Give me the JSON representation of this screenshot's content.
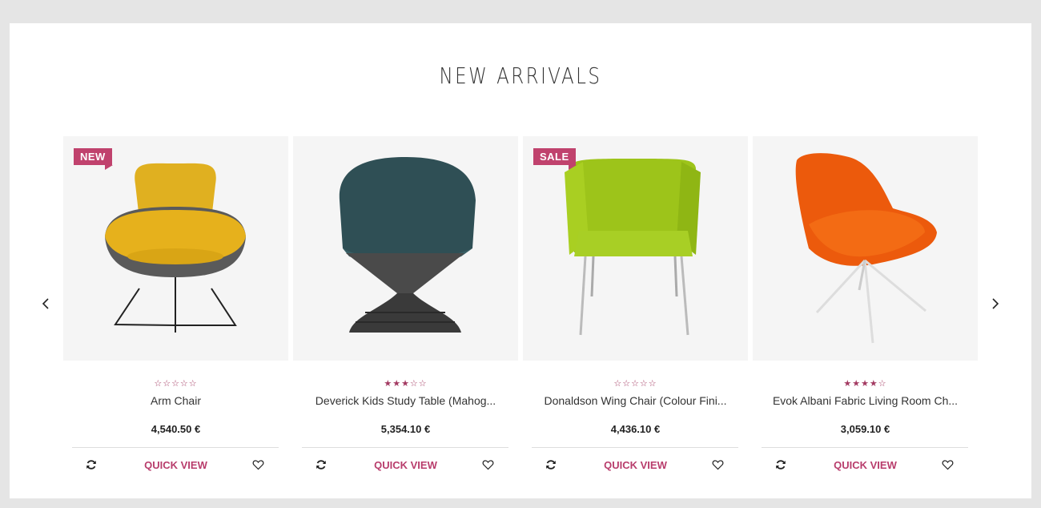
{
  "section": {
    "title": "NEW ARRIVALS"
  },
  "carousel": {
    "prev_icon": "chevron-left-icon",
    "next_icon": "chevron-right-icon"
  },
  "colors": {
    "accent": "#b83d6c",
    "badge_bg": "#c0426d",
    "image_bg": "#f5f5f5"
  },
  "products": [
    {
      "name": "Arm Chair",
      "price": "4,540.50 €",
      "rating": 0,
      "stars": "☆☆☆☆☆",
      "badge": "NEW",
      "quick_view": "QUICK VIEW"
    },
    {
      "name": "Deverick Kids Study Table (Mahog...",
      "price": "5,354.10 €",
      "rating": 3,
      "stars": "★★★☆☆",
      "badge": "",
      "quick_view": "QUICK VIEW"
    },
    {
      "name": "Donaldson Wing Chair (Colour Fini...",
      "price": "4,436.10 €",
      "rating": 0,
      "stars": "☆☆☆☆☆",
      "badge": "SALE",
      "quick_view": "QUICK VIEW"
    },
    {
      "name": "Evok Albani Fabric Living Room Ch...",
      "price": "3,059.10 €",
      "rating": 4,
      "stars": "★★★★☆",
      "badge": "",
      "quick_view": "QUICK VIEW"
    }
  ]
}
